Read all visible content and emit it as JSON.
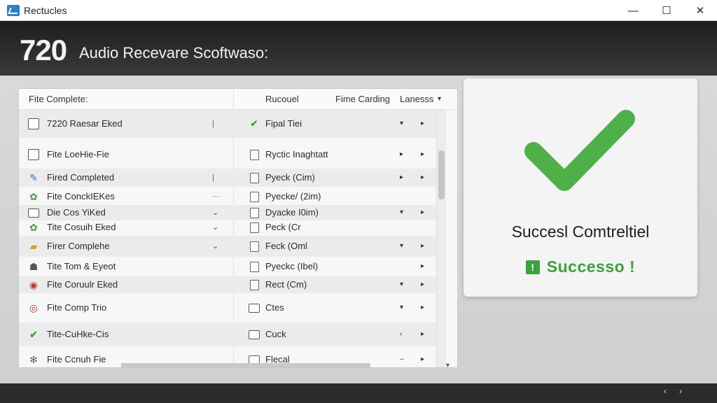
{
  "window": {
    "title": "Rectucles",
    "minimize": "—",
    "maximize": "☐",
    "close": "✕"
  },
  "header": {
    "number": "720",
    "title": "Audio Recevare Scoftwaso:"
  },
  "list": {
    "columns": {
      "name": "Fite Complete:",
      "status": "Rucouel",
      "time": "Fime Carding",
      "lang": "Lanesss",
      "caret": "▾"
    },
    "rows": [
      {
        "icon": "box-icon",
        "name": "7220 Raesar Eked",
        "mark": "|",
        "status_icon": "check-icon",
        "status": "Fipal Tiei",
        "chev1": "▾",
        "chev2": "▸"
      },
      {
        "icon": "box-icon",
        "name": "Fite LoeHie-Fie",
        "mark": "",
        "status_icon": "doc-icon",
        "status": "Ryctic Inaghtatt",
        "chev1": "▸",
        "chev2": "▸"
      },
      {
        "icon": "pencil-icon",
        "name": "Fired Completed",
        "mark": "|",
        "status_icon": "doc-icon",
        "status": "Pyeck (Cim)",
        "chev1": "▸",
        "chev2": "▸"
      },
      {
        "icon": "gear-icon",
        "name": "Fite ConckIEKes",
        "mark": "···",
        "status_icon": "doc-icon",
        "status": "Pyecke/ (2im)",
        "chev1": "",
        "chev2": ""
      },
      {
        "icon": "folder-icon",
        "name": "Die Cos YiKed",
        "mark": "⌄",
        "status_icon": "doc-icon",
        "status": "Dyacke I0im)",
        "chev1": "▾",
        "chev2": "▸"
      },
      {
        "icon": "gear-icon",
        "name": "Tite Cosuih Eked",
        "mark": "⌄",
        "status_icon": "doc-icon",
        "status": "Peck (Cr",
        "chev1": "",
        "chev2": ""
      },
      {
        "icon": "note-icon",
        "name": "Firer Complehe",
        "mark": "⌄",
        "status_icon": "doc-icon",
        "status": "Feck (Oml",
        "chev1": "▾",
        "chev2": "▸"
      },
      {
        "icon": "person-icon",
        "name": "Tite Tom & Eyeot",
        "mark": "",
        "status_icon": "doc-icon",
        "status": "Pyeckc (Ibel)",
        "chev1": "",
        "chev2": "▸"
      },
      {
        "icon": "record-icon",
        "name": "Fite Coruulr Eked",
        "mark": "",
        "status_icon": "doc-icon",
        "status": "Rect (Cm)",
        "chev1": "▾",
        "chev2": "▸"
      },
      {
        "icon": "circle-icon",
        "name": "Fite Comp Trio",
        "mark": "",
        "status_icon": "folder-icon",
        "status": "Ctes",
        "chev1": "▾",
        "chev2": "▸"
      },
      {
        "icon": "check-icon",
        "name": "Tite-CuHke-Cis",
        "mark": "",
        "status_icon": "folder-icon",
        "status": "Cuck",
        "chev1": "‹",
        "chev2": "▸"
      },
      {
        "icon": "settings-icon",
        "name": "Fite Ccnuh Fie",
        "mark": "",
        "status_icon": "image-icon",
        "status": "Flecal",
        "chev1": "–",
        "chev2": "▸"
      }
    ]
  },
  "card": {
    "title": "Succesl Comtreltiel",
    "badge": "!",
    "status": "Successo !"
  },
  "colors": {
    "accent_green": "#3da13d",
    "check_green": "#4fb04a"
  },
  "bottom_nav": {
    "prev": "‹",
    "next": "›"
  }
}
